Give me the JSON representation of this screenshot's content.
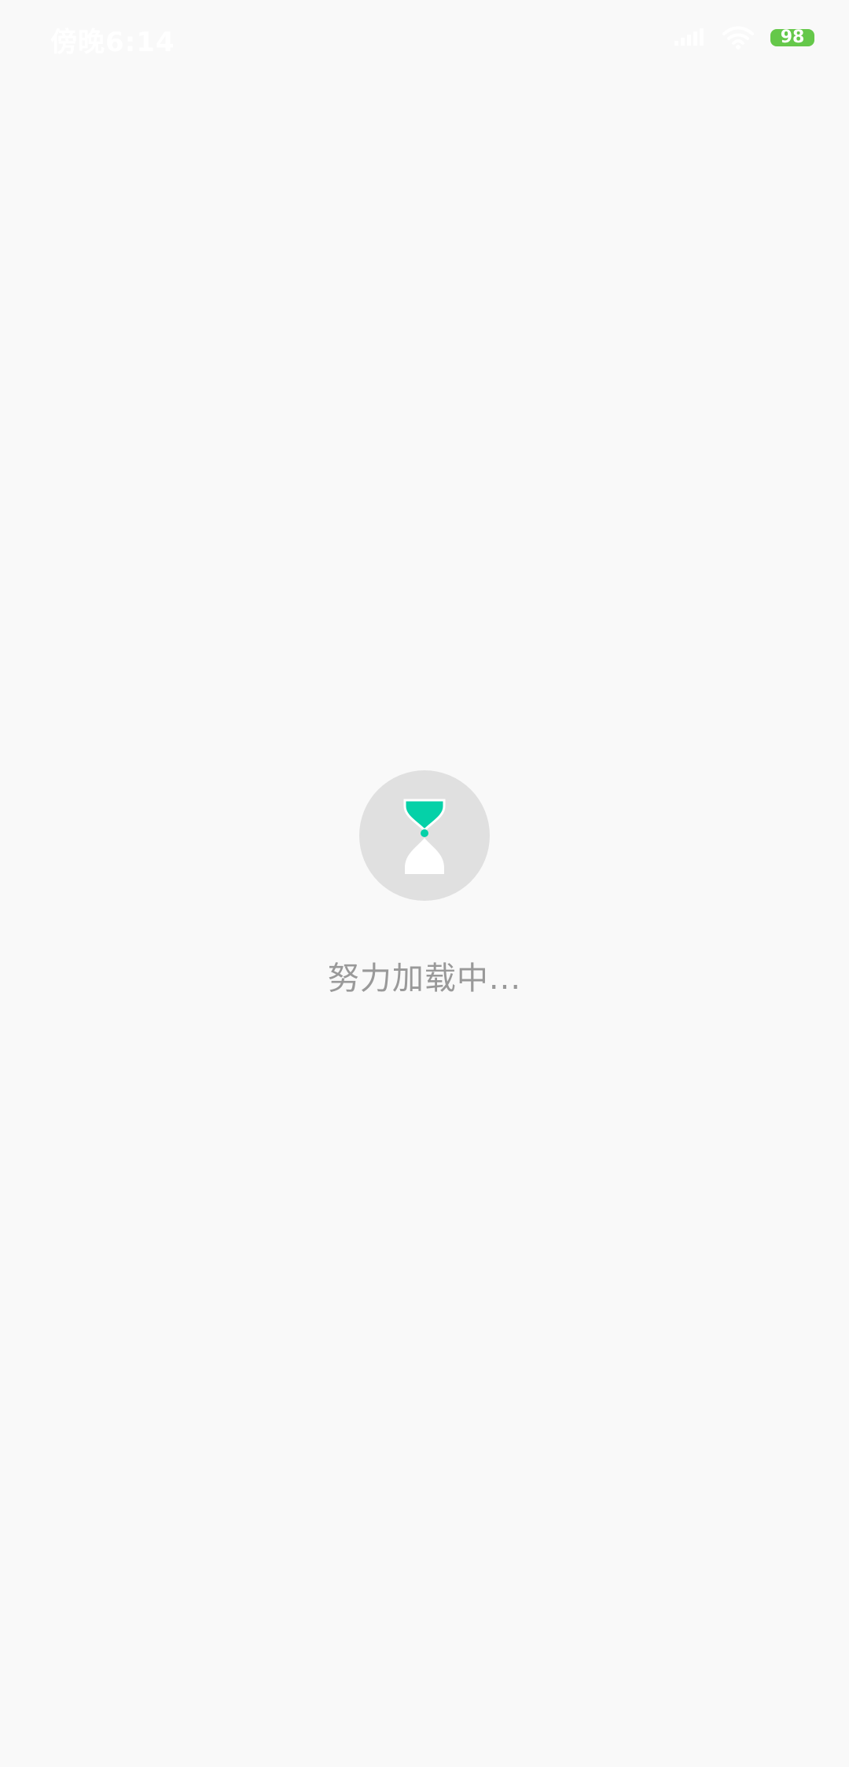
{
  "status_bar": {
    "time": "傍晚6:14",
    "battery": "98",
    "icons": {
      "signal": "signal-icon",
      "wifi": "wifi-icon",
      "battery": "battery-icon"
    },
    "colors": {
      "battery": "#65c84a",
      "text": "#ffffff"
    }
  },
  "loading": {
    "icon": "hourglass-icon",
    "text": "努力加载中...",
    "colors": {
      "circle": "#e0e0e0",
      "sand_top": "#05d1a8",
      "sand_bottom": "#ffffff",
      "text": "#999999"
    }
  }
}
